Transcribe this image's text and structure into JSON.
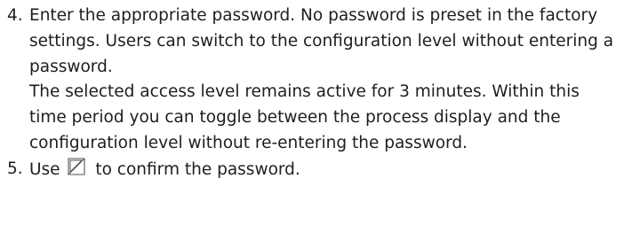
{
  "steps": [
    {
      "number": "4.",
      "paragraphs": [
        "Enter the appropriate password. No password is preset in the factory settings. Users can switch to the configuration level without entering a password.",
        "The selected access level remains active for 3 minutes. Within this time period you can toggle between the process display and the configuration level without re-entering the password."
      ]
    },
    {
      "number": "5.",
      "text_before_icon": "Use",
      "icon": "enter-key-icon",
      "text_after_icon": "to confirm the password."
    }
  ]
}
